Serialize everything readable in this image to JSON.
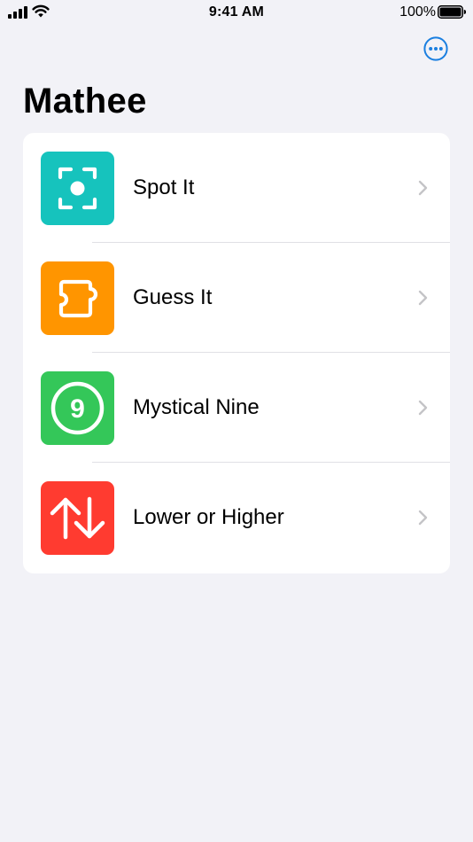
{
  "status_bar": {
    "time": "9:41 AM",
    "battery_percent": "100%",
    "battery_level": 1.0
  },
  "nav": {
    "title": "Mathee",
    "more_icon": "ellipsis-circle-icon",
    "accent_color": "#1a7fe0"
  },
  "items": [
    {
      "label": "Spot It",
      "icon": "viewfinder-dot-icon",
      "color": "#16c3bd"
    },
    {
      "label": "Guess It",
      "icon": "puzzle-piece-icon",
      "color": "#ff9500"
    },
    {
      "label": "Mystical Nine",
      "icon": "nine-circle-icon",
      "color": "#34c759",
      "icon_text": "9"
    },
    {
      "label": "Lower or Higher",
      "icon": "up-down-arrows-icon",
      "color": "#ff3b30"
    }
  ]
}
